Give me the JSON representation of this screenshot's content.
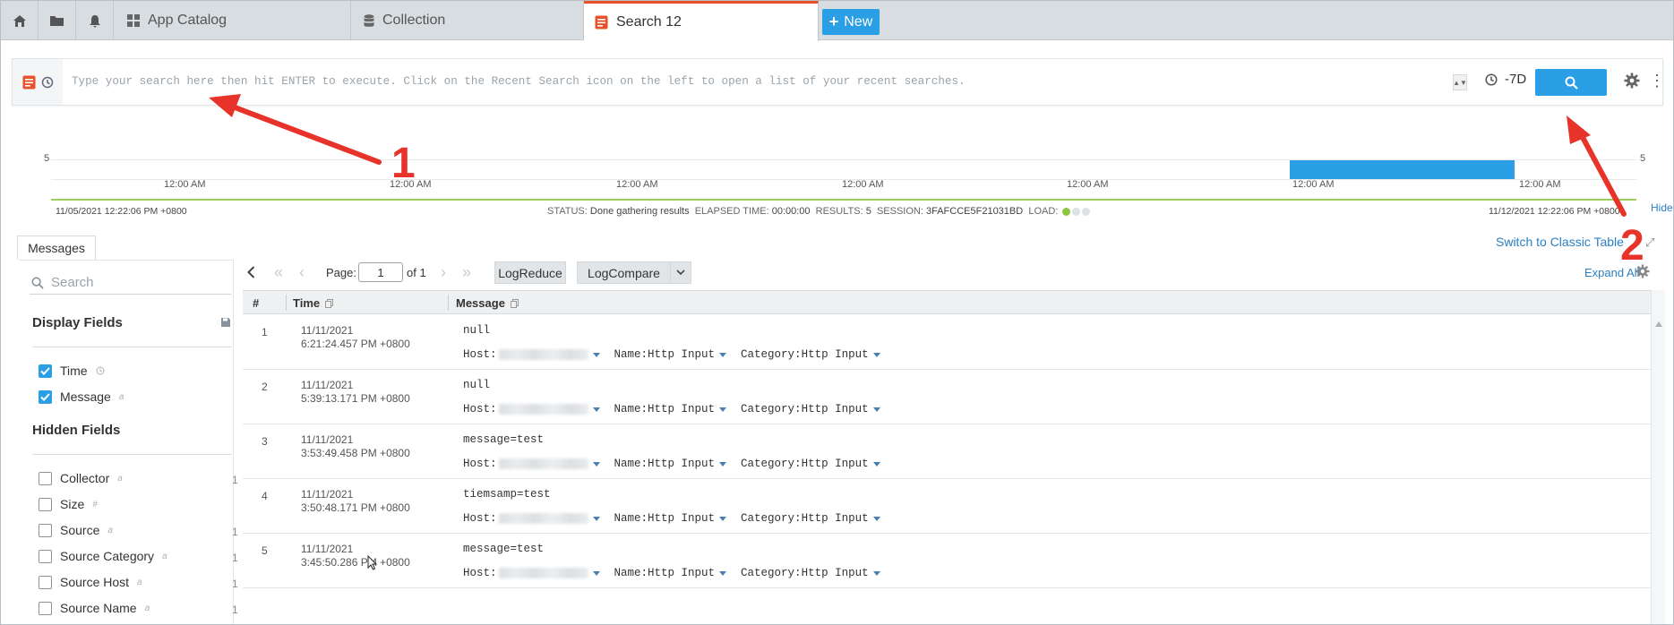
{
  "tabs": {
    "app_catalog": "App Catalog",
    "collection": "Collection",
    "search": "Search 12",
    "new_label": "New"
  },
  "search": {
    "placeholder": "Type your search here then hit ENTER to execute. Click on the Recent Search icon on the left to open a list of your recent searches.",
    "time_range": "-7D"
  },
  "histogram": {
    "y_max_label": "5",
    "tick_labels": [
      "12:00 AM",
      "12:00 AM",
      "12:00 AM",
      "12:00 AM",
      "12:00 AM",
      "12:00 AM",
      "12:00 AM"
    ],
    "start_time": "11/05/2021 12:22:06 PM +0800",
    "end_time": "11/12/2021 12:22:06 PM +0800",
    "bar_count": 5,
    "hide_label": "Hide"
  },
  "status": {
    "status_label": "STATUS:",
    "status_value": "Done gathering results",
    "elapsed_label": "ELAPSED TIME:",
    "elapsed_value": "00:00:00",
    "results_label": "RESULTS:",
    "results_value": "5",
    "session_label": "SESSION:",
    "session_value": "3FAFCCE5F21031BD",
    "load_label": "LOAD:"
  },
  "messages_tab": "Messages",
  "switch_link": "Switch to Classic Table",
  "fields_panel": {
    "search_placeholder": "Search",
    "display_title": "Display Fields",
    "display_fields": [
      {
        "name": "Time"
      },
      {
        "name": "Message",
        "type": "a"
      }
    ],
    "hidden_title": "Hidden Fields",
    "hidden_fields": [
      {
        "name": "Collector",
        "type": "a",
        "count": "1"
      },
      {
        "name": "Size",
        "type": "#",
        "count": ""
      },
      {
        "name": "Source",
        "type": "a",
        "count": "1"
      },
      {
        "name": "Source Category",
        "type": "a",
        "count": "1"
      },
      {
        "name": "Source Host",
        "type": "a",
        "count": "1"
      },
      {
        "name": "Source Name",
        "type": "a",
        "count": "1"
      }
    ]
  },
  "toolbar": {
    "page_label": "Page:",
    "page_value": "1",
    "of_label": "of 1",
    "logreduce": "LogReduce",
    "logcompare": "LogCompare",
    "expand_all": "Expand All"
  },
  "table": {
    "col_num": "#",
    "col_time": "Time",
    "col_message": "Message",
    "rows": [
      {
        "num": "1",
        "date": "11/11/2021",
        "time": "6:21:24.457 PM +0800",
        "message": "null",
        "host_label": "Host:",
        "name_label": "Name:",
        "name_value": "Http Input",
        "cat_label": "Category:",
        "cat_value": "Http Input"
      },
      {
        "num": "2",
        "date": "11/11/2021",
        "time": "5:39:13.171 PM +0800",
        "message": "null",
        "host_label": "Host:",
        "name_label": "Name:",
        "name_value": "Http Input",
        "cat_label": "Category:",
        "cat_value": "Http Input"
      },
      {
        "num": "3",
        "date": "11/11/2021",
        "time": "3:53:49.458 PM +0800",
        "message": "message=test",
        "host_label": "Host:",
        "name_label": "Name:",
        "name_value": "Http Input",
        "cat_label": "Category:",
        "cat_value": "Http Input"
      },
      {
        "num": "4",
        "date": "11/11/2021",
        "time": "3:50:48.171 PM +0800",
        "message": "tiemsamp=test",
        "host_label": "Host:",
        "name_label": "Name:",
        "name_value": "Http Input",
        "cat_label": "Category:",
        "cat_value": "Http Input"
      },
      {
        "num": "5",
        "date": "11/11/2021",
        "time": "3:45:50.286 PM +0800",
        "message": "message=test",
        "host_label": "Host:",
        "name_label": "Name:",
        "name_value": "Http Input",
        "cat_label": "Category:",
        "cat_value": "Http Input"
      }
    ]
  },
  "annotations": {
    "label_1": "1",
    "label_2": "2"
  },
  "colors": {
    "accent": "#2a9fe6",
    "active_tab": "#e9502c",
    "annotation": "#e7332a",
    "load_good": "#8cc63f"
  }
}
